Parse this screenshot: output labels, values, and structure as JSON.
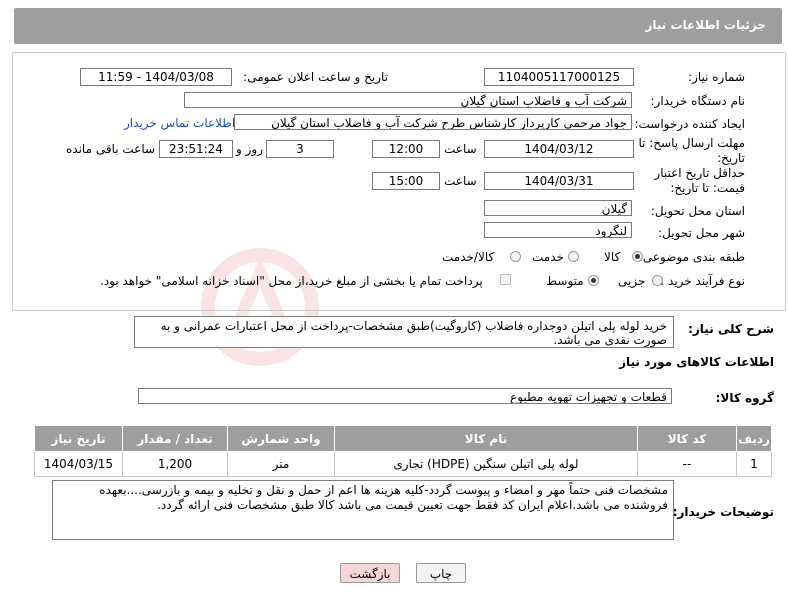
{
  "header": {
    "title": "جزئیات اطلاعات نیاز"
  },
  "fields": {
    "need_number_label": "شماره نیاز:",
    "need_number": "1104005117000125",
    "announce_label": "تاریخ و ساعت اعلان عمومی:",
    "announce_value": "1404/03/08 - 11:59",
    "buyer_org_label": "نام دستگاه خریدار:",
    "buyer_org": "شرکت آب و فاضلاب استان گیلان",
    "creator_label": "ایجاد کننده درخواست:",
    "creator": "جواد مرحمی کارپرداز کارشناس طرح شرکت آب و فاضلاب استان گیلان",
    "contact_link": "اطلاعات تماس خریدار",
    "deadline_label": "مهلت ارسال پاسخ: تا تاریخ:",
    "deadline_date": "1404/03/12",
    "time_label": "ساعت",
    "deadline_time": "12:00",
    "days_value": "3",
    "days_label": "روز و",
    "remaining_time": "23:51:24",
    "remaining_label": "ساعت باقی مانده",
    "validity_label": "حداقل تاریخ اعتبار قیمت: تا تاریخ:",
    "validity_date": "1404/03/31",
    "validity_time": "15:00",
    "province_label": "استان محل تحویل:",
    "province": "گیلان",
    "city_label": "شهر محل تحویل:",
    "city": "لنگرود",
    "category_label": "طبقه بندی موضوعی:",
    "category_options": [
      "کالا",
      "خدمت",
      "کالا/خدمت"
    ],
    "category_selected": "کالا",
    "process_label": "نوع فرآیند خرید :",
    "process_options": [
      "جزیی",
      "متوسط"
    ],
    "process_selected": "متوسط",
    "payment_note": "پرداخت تمام یا بخشی از مبلغ خرید،از محل \"اسناد خزانه اسلامی\" خواهد بود."
  },
  "description": {
    "label": "شرح کلی نیاز:",
    "text": "خرید لوله پلی اتیلن دوجداره فاضلاب (کاروگیت)طبق مشخصات-پرداخت از محل اعتبارات عمرانی و به صورت نقدی می باشد."
  },
  "goods_section": {
    "title": "اطلاعات کالاهای مورد نیاز",
    "group_label": "گروه کالا:",
    "group_value": "قطعات و تجهیزات تهویه مطبوع"
  },
  "table": {
    "headers": [
      "ردیف",
      "کد کالا",
      "نام کالا",
      "واحد شمارش",
      "تعداد / مقدار",
      "تاریخ نیاز"
    ],
    "rows": [
      [
        "1",
        "--",
        "لوله پلی اتیلن سنگین (HDPE) تجاری",
        "متر",
        "1,200",
        "1404/03/15"
      ]
    ]
  },
  "buyer_notes": {
    "label": "توضیحات خریدار:",
    "text": "مشخصات فنی حتماً مهر و امضاء و پیوست گردد-کلیه هزینه ها اعم از حمل و نقل و تخلیه و بیمه و بازرسی....بعهده فروشنده می باشد.اعلام ایران کد فقط جهت تعیین قیمت می باشد کالا طبق مشخصات فنی ارائه گردد."
  },
  "buttons": {
    "print": "چاپ",
    "back": "بازگشت"
  },
  "watermark_text": "AriaTender.neT",
  "colors": {
    "header_bg": "#9e9e9e",
    "link": "#1a4fb5",
    "back_button_bg": "#f6d6d6",
    "watermark": "#d32f2f"
  }
}
